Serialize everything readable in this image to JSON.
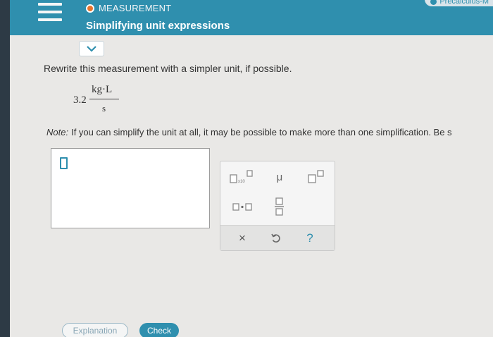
{
  "header": {
    "topic": "MEASUREMENT",
    "title": "Simplifying unit expressions",
    "course_tag": "Precalculus-M",
    "accent_color": "#2f8fae",
    "topic_dot_color": "#e8732c",
    "menu_icon": "hamburger-menu-icon"
  },
  "question": {
    "prompt": "Rewrite this measurement with a simpler unit, if possible.",
    "coefficient": "3.2",
    "numerator_unit": "kg·L",
    "denominator_unit": "s",
    "note_label": "Note:",
    "note_text": "If you can simplify the unit at all, it may be possible to make more than one simplification. Be s"
  },
  "answer": {
    "value": ""
  },
  "keypad": {
    "mu_label": "μ",
    "dot_label": "·",
    "clear_label": "×",
    "help_label": "?",
    "icons": [
      "scientific-notation-icon",
      "superscript-icon",
      "multiply-dot-icon",
      "fraction-icon",
      "undo-icon"
    ]
  },
  "buttons": {
    "explanation": "Explanation",
    "check": "Check"
  }
}
